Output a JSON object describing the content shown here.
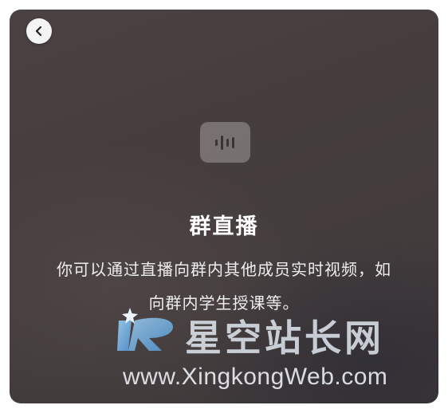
{
  "dialog": {
    "back_icon": "chevron-left-icon",
    "feature_icon": "audio-waveform-icon",
    "title": "群直播",
    "description_line1": "你可以通过直播向群内其他成员实时视频，如",
    "description_line2": "向群内学生授课等。"
  },
  "watermark": {
    "logo": "xingkong-logo",
    "name": "星空站长网",
    "url": "www.XingkongWeb.com"
  },
  "colors": {
    "card_background": "#463e3e",
    "back_button": "#f4f4f4",
    "feature_icon_bg": "#8a8585",
    "title_text": "#ffffff"
  }
}
